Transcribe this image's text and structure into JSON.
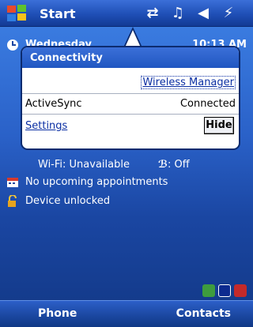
{
  "topbar": {
    "start_label": "Start",
    "icons": [
      "connectivity-icon",
      "speaker-icon",
      "volume-icon",
      "battery-icon"
    ]
  },
  "today": {
    "date_label": "Wednesday",
    "time_label": "10:13 AM",
    "wifi_label": "Wi-Fi: Unavailable",
    "bluetooth_label": ": Off",
    "appointments_label": "No upcoming appointments",
    "lock_label": "Device unlocked"
  },
  "popup": {
    "title": "Connectivity",
    "wireless_manager_link": "Wireless Manager",
    "activesync_label": "ActiveSync",
    "activesync_status": "Connected",
    "settings_link": "Settings",
    "hide_button": "Hide"
  },
  "softkeys": {
    "left": "Phone",
    "right": "Contacts"
  },
  "colors": {
    "accent": "#1f4fb6",
    "link": "#0b2fa3"
  }
}
